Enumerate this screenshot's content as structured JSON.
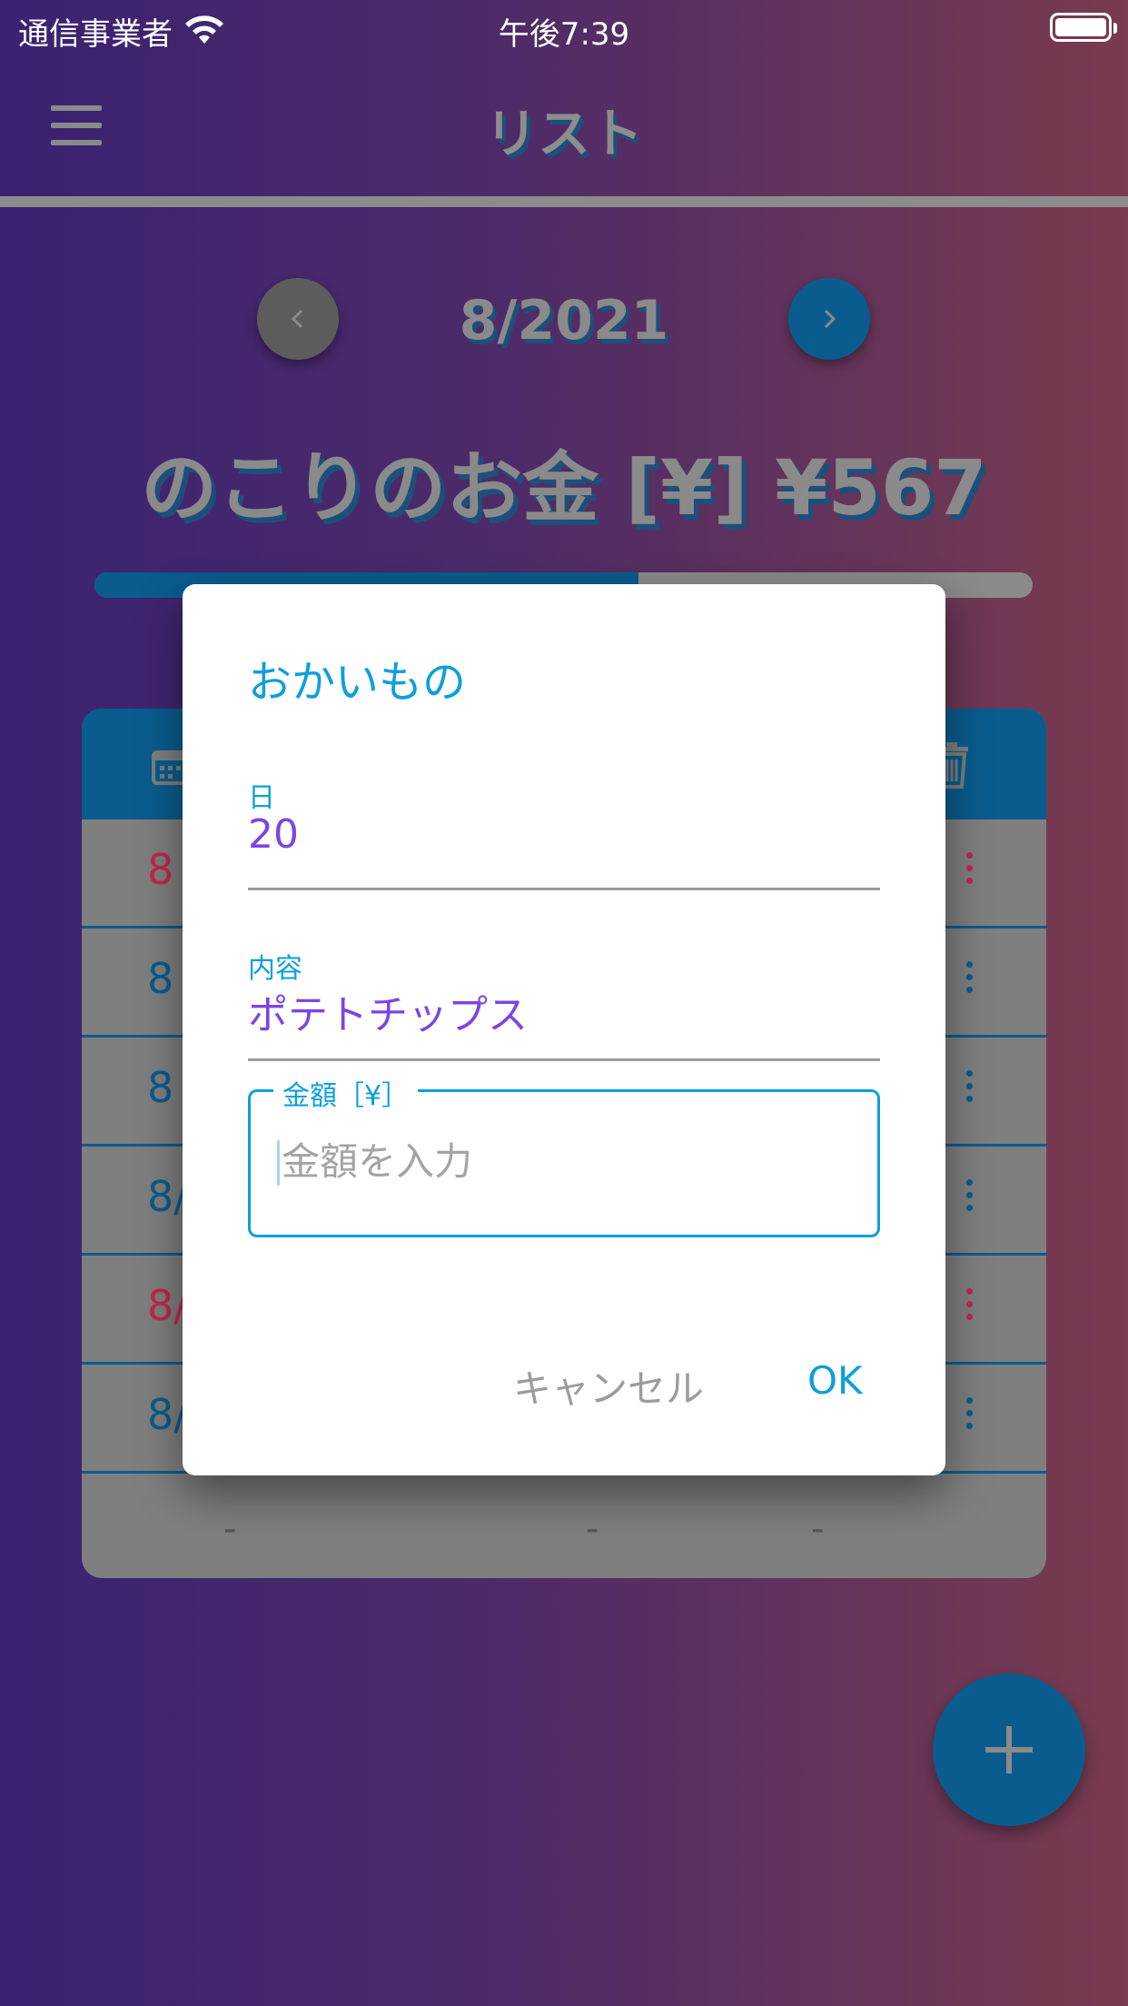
{
  "status_bar": {
    "carrier": "通信事業者",
    "time": "午後7:39"
  },
  "app_bar": {
    "title": "リスト"
  },
  "month_nav": {
    "label": "8/2021"
  },
  "summary": {
    "remaining_label": "のこりのお金 [¥] ¥567",
    "progress_fraction": 0.58
  },
  "table": {
    "rows": [
      {
        "date": "8",
        "color": "#c2264d"
      },
      {
        "date": "8",
        "color": "#0a5c8e"
      },
      {
        "date": "8",
        "color": "#0a5c8e"
      },
      {
        "date": "8/",
        "color": "#0a5c8e"
      },
      {
        "date": "8/",
        "color": "#c2264d"
      },
      {
        "date": "8/",
        "color": "#0a5c8e"
      }
    ],
    "footer": [
      "-",
      "-",
      "-"
    ]
  },
  "dialog": {
    "title": "おかいもの",
    "day_label": "日",
    "day_value": "20",
    "content_label": "内容",
    "content_value": "ポテトチップス",
    "amount_label": "金額［¥］",
    "amount_placeholder": "金額を入力",
    "cancel_label": "キャンセル",
    "ok_label": "OK"
  },
  "colors": {
    "accent": "#0e9fdd",
    "value_text": "#7b45e6",
    "primary_dark": "#0a5c8e",
    "expense_red": "#c2264d"
  }
}
